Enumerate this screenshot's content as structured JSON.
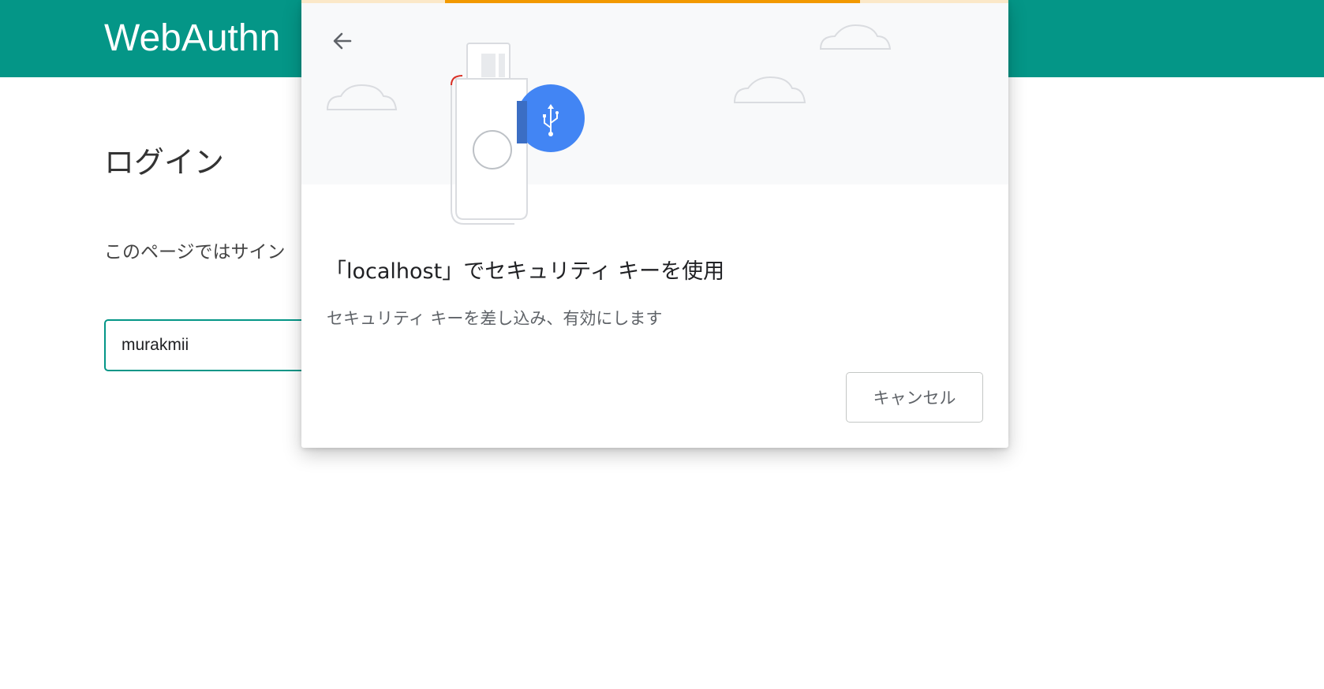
{
  "page": {
    "app_title": "WebAuthn",
    "heading": "ログイン",
    "description": "このページではサイン",
    "username_value": "murakmii"
  },
  "dialog": {
    "title": "「localhost」でセキュリティ キーを使用",
    "description": "セキュリティ キーを差し込み、有効にします",
    "cancel_label": "キャンセル",
    "back_icon": "arrow-left-icon",
    "illustration_icons": [
      "security-key-icon",
      "usb-icon",
      "cloud-icon"
    ],
    "progress": "indeterminate"
  },
  "colors": {
    "header": "#049687",
    "input_border": "#049687",
    "progress": "#f29900",
    "progress_track": "#fbe8c8",
    "usb_badge": "#4285f4",
    "usb_badge_shade": "#3b6ec4",
    "illustration_bg": "#f8f9fa",
    "key_accent": "#d93025"
  }
}
